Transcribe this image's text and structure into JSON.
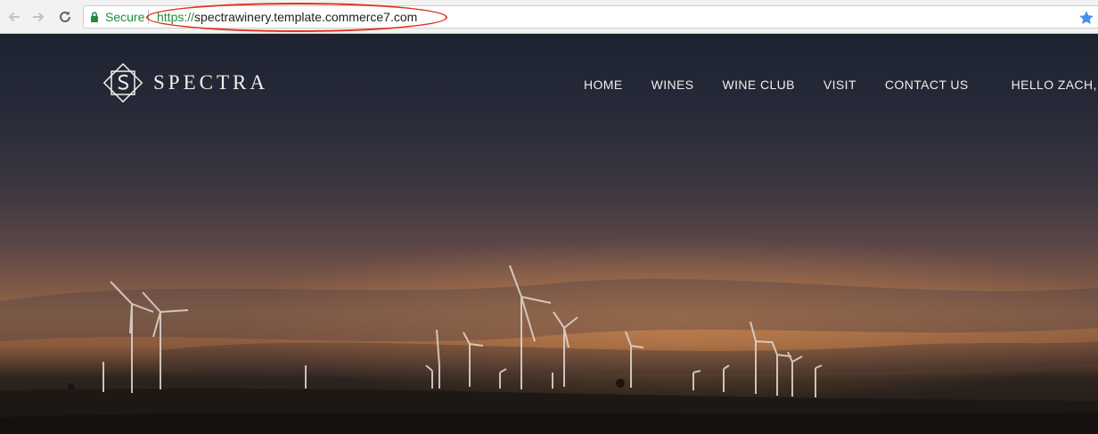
{
  "browser": {
    "secure_label": "Secure",
    "url_scheme": "https://",
    "url_host": "spectrawinery.template.commerce7.com",
    "icons": [
      "back-arrow-icon",
      "forward-arrow-icon",
      "reload-icon",
      "lock-icon",
      "star-icon"
    ],
    "annotation_color": "#e0321e"
  },
  "site": {
    "brand": "SPECTRA",
    "nav": {
      "home": "HOME",
      "wines": "WINES",
      "wine_club": "WINE CLUB",
      "visit": "VISIT",
      "contact": "CONTACT US",
      "greeting": "HELLO ZACH, L"
    }
  },
  "colors": {
    "secure_green": "#1e8e3e",
    "star_blue": "#4a8ef0",
    "nav_text": "#f2ede8"
  }
}
